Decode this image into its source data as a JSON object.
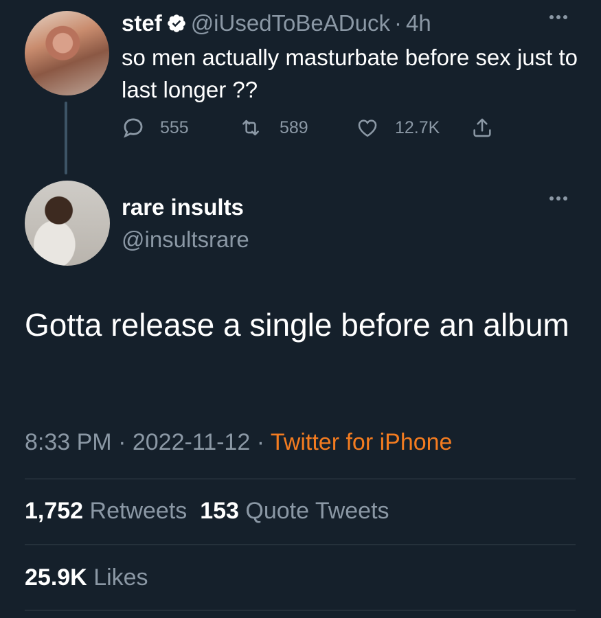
{
  "parent_tweet": {
    "name": "stef",
    "handle": "@iUsedToBeADuck",
    "separator": "·",
    "time": "4h",
    "text": "so men actually masturbate before sex just to last longer ??",
    "replies": "555",
    "retweets": "589",
    "likes": "12.7K",
    "verified": true
  },
  "main_tweet": {
    "name": "rare insults",
    "handle": "@insultsrare",
    "text": "Gotta release a single before an album",
    "time": "8:33 PM",
    "date": "2022-11-12",
    "dot": "·",
    "source": "Twitter for iPhone",
    "retweets_count": "1,752",
    "retweets_label": "Retweets",
    "quote_count": "153",
    "quote_label": "Quote Tweets",
    "likes_count": "25.9K",
    "likes_label": "Likes"
  },
  "colors": {
    "background": "#15202b",
    "secondary_text": "#8b98a5",
    "source_link": "#f47c20",
    "divider": "#38444d"
  },
  "icons": [
    "verified-badge-icon",
    "more-icon",
    "reply-icon",
    "retweet-icon",
    "like-icon",
    "share-icon"
  ]
}
